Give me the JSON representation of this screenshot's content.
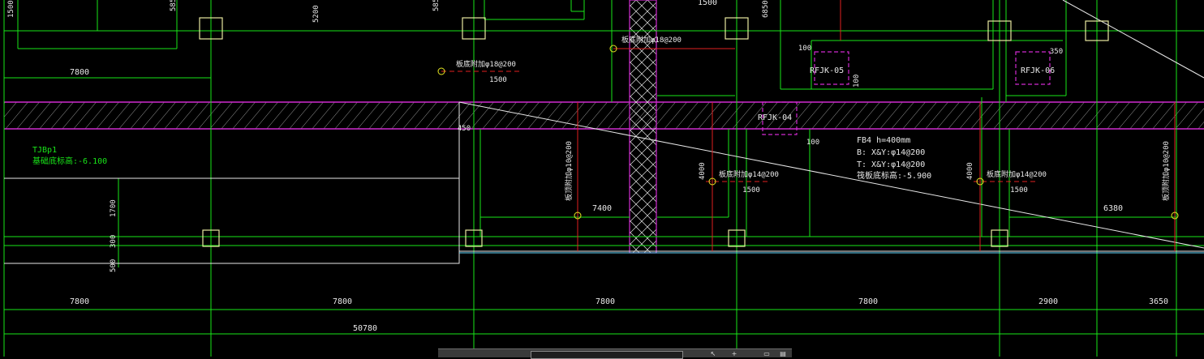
{
  "colors": {
    "background": "#000000",
    "grid_line": "#19e619",
    "wall": "#d02ad0",
    "rebar": "#e02020",
    "column": "#e8e8a0",
    "cyan": "#5fd7ff",
    "text": "#e8e8e8"
  },
  "dimensions": {
    "bottom_spans": [
      "7800",
      "7800",
      "7800",
      "7800",
      "2900",
      "3650"
    ],
    "total": "50780",
    "top_left_span": "7800",
    "span_7400": "7400",
    "span_6380": "6380",
    "d_1500_top": "1500",
    "d_585_a": "585",
    "d_585_b": "585",
    "d_5200": "5200",
    "d_1500_b": "1500",
    "d_6850": "6850",
    "d_1700": "1700",
    "d_300": "300",
    "d_500": "500",
    "d_450": "450",
    "d_4000_a": "4000",
    "d_4000_b": "4000",
    "d_100_a": "100",
    "d_100_b": "100",
    "d_100_c": "100",
    "d_350": "350",
    "d_1500_c": "1500",
    "d_1500_d": "1500",
    "d_1500_e": "1500"
  },
  "labels": {
    "tjbp": "TJBp1",
    "tjbp_elev": "基础底标高:-6.100",
    "rebar_top_mid": "板底附加φ18@200",
    "rebar_left": "板底附加φ18@200",
    "rebar_mid": "板底附加φ14@200",
    "rebar_right": "板底附加φ14@200",
    "rebar_vert_left": "板顶附加φ10@200",
    "rebar_vert_right": "板顶附加φ10@200",
    "fbe_title": "FB4  h=400mm",
    "fbe_b": "B: X&Y:φ14@200",
    "fbe_t": "T: X&Y:φ14@200",
    "fbe_elev": "筏板底标高:-5.900",
    "rfjk04": "RFJK-04",
    "rfjk05": "RFJK-05",
    "rfjk06": "RFJK-06"
  }
}
